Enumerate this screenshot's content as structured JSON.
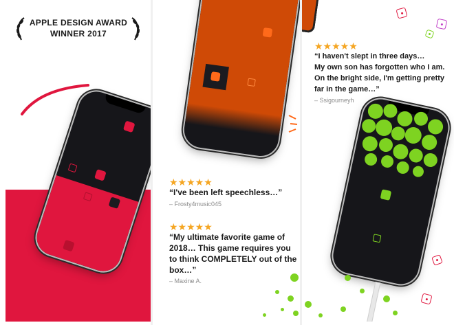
{
  "award": {
    "line1": "APPLE DESIGN AWARD",
    "line2": "WINNER 2017"
  },
  "reviews": [
    {
      "stars": "★★★★★",
      "quote": "“I've been left speechless…”",
      "author": "– Frosty4music045"
    },
    {
      "stars": "★★★★★",
      "quote_lines": [
        "“My ultimate favorite game of",
        "2018… This game requires you",
        "to think COMPLETELY out of the",
        "box…”"
      ],
      "author": "– Maxine A."
    },
    {
      "stars": "★★★★★",
      "quote_lines": [
        "“I haven't slept in three days…",
        "My own son has forgotten who I am.",
        "On the bright side, I'm getting pretty",
        "far in the game…”"
      ],
      "author": "– Ssigourneyh"
    }
  ],
  "colors": {
    "red": "#e0163e",
    "orange": "#cf4a06",
    "orange_square": "#ff6a1a",
    "green": "#7ed321",
    "phone_body": "#16161a"
  },
  "icons": [
    "laurel-left-icon",
    "laurel-right-icon",
    "dice-icon"
  ]
}
